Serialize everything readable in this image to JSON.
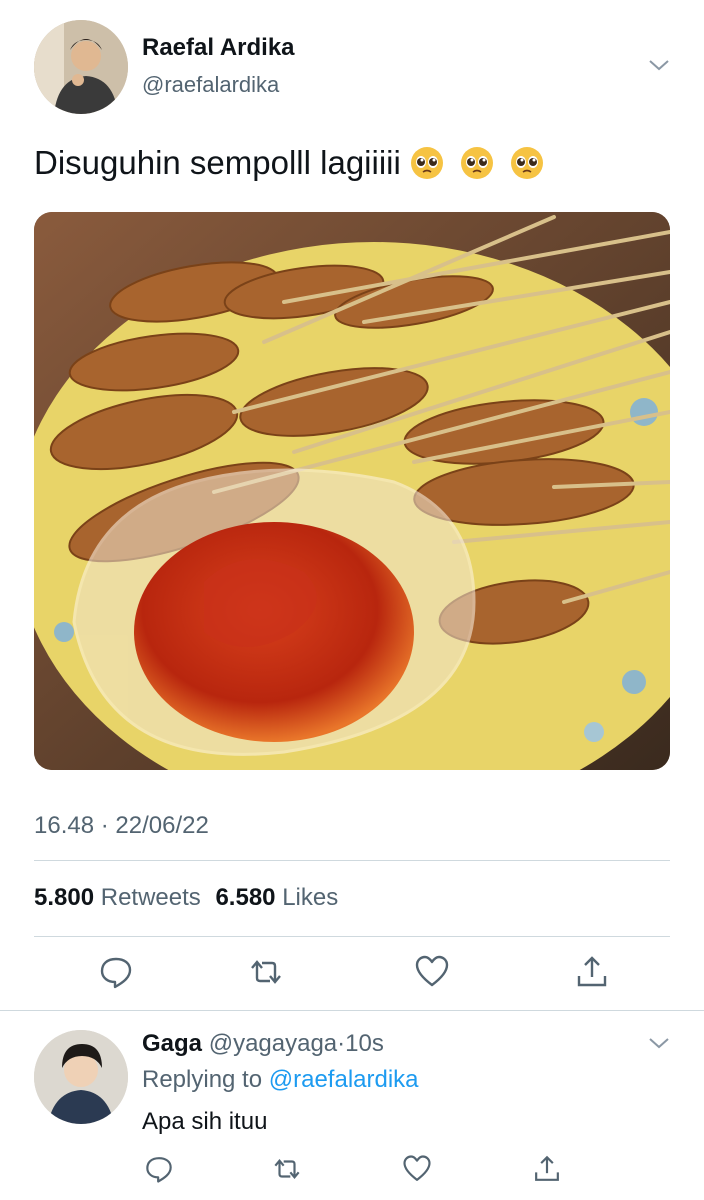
{
  "tweet": {
    "author_name": "Raefal Ardika",
    "author_handle": "@raefalardika",
    "text": "Disuguhin sempolll lagiiiii",
    "emojis": [
      "pleading-face-emoji",
      "pleading-face-emoji",
      "pleading-face-emoji"
    ],
    "timestamp": "16.48 · 22/06/22",
    "retweets_count": "5.800",
    "retweets_label": "Retweets",
    "likes_count": "6.580",
    "likes_label": "Likes",
    "actions": [
      "reply-icon",
      "retweet-icon",
      "like-icon",
      "share-icon"
    ]
  },
  "reply": {
    "author_name": "Gaga",
    "author_handle": "@yagayaga",
    "separator": "·",
    "time": "10s",
    "replying_prefix": "Replying to",
    "replying_to": "@raefalardika",
    "text": "Apa sih ituu",
    "actions": [
      "reply-icon",
      "retweet-icon",
      "like-icon",
      "share-icon"
    ]
  },
  "colors": {
    "text_primary": "#0f1419",
    "text_secondary": "#536471",
    "link": "#1d9bf0",
    "divider": "#cfd9de"
  }
}
